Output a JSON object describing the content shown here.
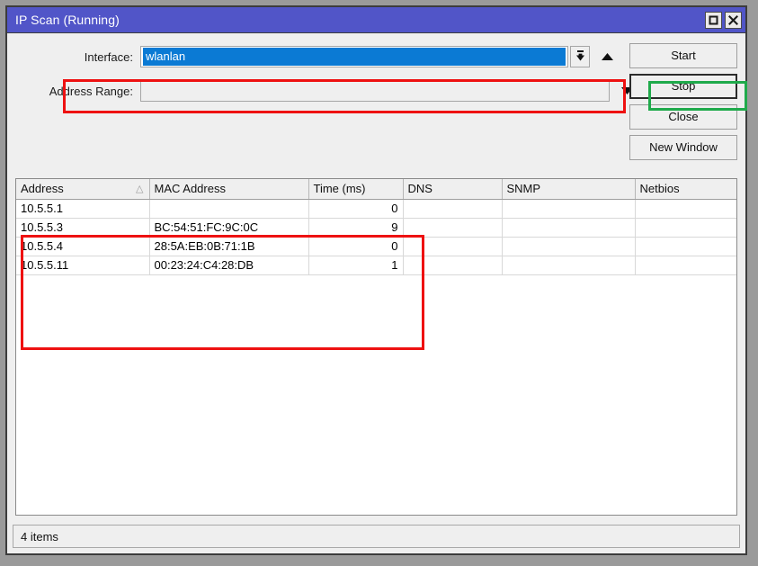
{
  "window": {
    "title": "IP Scan (Running)",
    "titlebar_color": "#5155c8",
    "controls": [
      {
        "name": "maximize",
        "glyph": "restore-icon"
      },
      {
        "name": "close",
        "glyph": "close-icon"
      }
    ]
  },
  "form": {
    "interface": {
      "label": "Interface:",
      "value": "wlanlan",
      "placeholder": "",
      "selected": true,
      "dropdown_icon": "down-arrow-to-bar-icon",
      "spinner_icon": "triangle-up-icon"
    },
    "address_range": {
      "label": "Address Range:",
      "value": "",
      "placeholder": "",
      "dropdown_icon": "triangle-down-icon"
    }
  },
  "buttons": [
    {
      "label": "Start",
      "name": "start-button",
      "state": "highlighted"
    },
    {
      "label": "Stop",
      "name": "stop-button",
      "state": "focused"
    },
    {
      "label": "Close",
      "name": "close-button",
      "state": "normal"
    },
    {
      "label": "New Window",
      "name": "new-window-button",
      "state": "normal"
    }
  ],
  "table": {
    "columns": [
      {
        "label": "Address",
        "sorted": "ascending",
        "sort_glyph": "sort-asc-icon"
      },
      {
        "label": "MAC Address"
      },
      {
        "label": "Time (ms)"
      },
      {
        "label": "DNS"
      },
      {
        "label": "SNMP"
      },
      {
        "label": "Netbios"
      }
    ],
    "menu_icon": "triangle-down-icon",
    "rows": [
      {
        "address": "10.5.5.1",
        "mac": "",
        "time": "0",
        "dns": "",
        "snmp": "",
        "netbios": ""
      },
      {
        "address": "10.5.5.3",
        "mac": "BC:54:51:FC:9C:0C",
        "time": "9",
        "dns": "",
        "snmp": "",
        "netbios": ""
      },
      {
        "address": "10.5.5.4",
        "mac": "28:5A:EB:0B:71:1B",
        "time": "0",
        "dns": "",
        "snmp": "",
        "netbios": ""
      },
      {
        "address": "10.5.5.11",
        "mac": "00:23:24:C4:28:DB",
        "time": "1",
        "dns": "",
        "snmp": "",
        "netbios": ""
      }
    ]
  },
  "status": {
    "text": "4 items"
  },
  "annotations": {
    "interface_box_color": "#ee1111",
    "start_box_color": "#1faa4b",
    "table_box_color": "#ee1111"
  }
}
